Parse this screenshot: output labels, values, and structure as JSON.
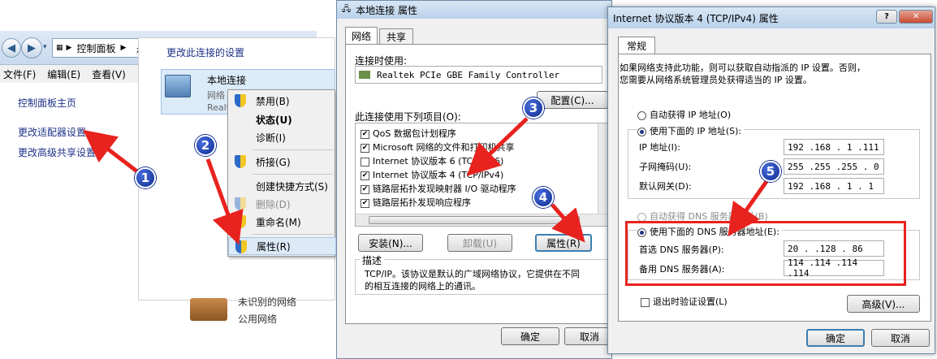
{
  "explorer": {
    "address": "控制面板",
    "address_tail": "核",
    "menu": [
      "文件(F)",
      "编辑(E)",
      "查看(V)"
    ],
    "links": [
      "控制面板主页",
      "更改适配器设置",
      "更改高级共享设置"
    ]
  },
  "adapters": {
    "header": "更改此连接的设置",
    "connection_name": "本地连接",
    "connection_sub1": "网络",
    "connection_sub2": "Realt",
    "unidentified": "未识别的网络",
    "public": "公用网络"
  },
  "context_menu": {
    "items": [
      {
        "label": "禁用(B)"
      },
      {
        "label": "状态(U)"
      },
      {
        "label": "诊断(I)"
      },
      {
        "label": "桥接(G)"
      },
      {
        "label": "创建快捷方式(S)"
      },
      {
        "label": "删除(D)"
      },
      {
        "label": "重命名(M)"
      },
      {
        "label": "属性(R)"
      }
    ]
  },
  "props": {
    "title": "本地连接 属性",
    "tabs": [
      "网络",
      "共享"
    ],
    "connect_using": "连接时使用:",
    "adapter": "Realtek PCIe GBE Family Controller",
    "configure": "配置(C)...",
    "items_label": "此连接使用下列项目(O):",
    "items": [
      {
        "label": "QoS 数据包计划程序",
        "checked": "✔"
      },
      {
        "label": "Microsoft 网络的文件和打印机共享",
        "checked": "✔"
      },
      {
        "label": "Internet 协议版本 6 (TCP/IPv6)",
        "checked": ""
      },
      {
        "label": "Internet 协议版本 4 (TCP/IPv4)",
        "checked": "✔"
      },
      {
        "label": "链路层拓扑发现映射器 I/O 驱动程序",
        "checked": "✔"
      },
      {
        "label": "链路层拓扑发现响应程序",
        "checked": "✔"
      }
    ],
    "install": "安装(N)...",
    "uninstall": "卸载(U)",
    "properties": "属性(R)",
    "desc_title": "描述",
    "desc_line1": "TCP/IP。该协议是默认的广域网络协议，它提供在不同",
    "desc_line2": "的相互连接的网络上的通讯。",
    "ok": "确定",
    "cancel": "取消"
  },
  "ipv4": {
    "title": "Internet 协议版本 4 (TCP/IPv4) 属性",
    "help_btn": "?",
    "close_btn": "✕",
    "tab": "常规",
    "intro1": "如果网络支持此功能，则可以获取自动指派的 IP 设置。否则，",
    "intro2": "您需要从网络系统管理员处获得适当的 IP 设置。",
    "auto_ip": "自动获得 IP 地址(O)",
    "manual_ip": "使用下面的 IP 地址(S):",
    "ip_label": "IP 地址(I):",
    "ip_value": "192 .168 . 1 .111",
    "mask_label": "子网掩码(U):",
    "mask_value": "255 .255 .255 . 0",
    "gateway_label": "默认网关(D):",
    "gateway_value": "192 .168 . 1 . 1",
    "auto_dns": "自动获得 DNS 服务器地址(B)",
    "manual_dns": "使用下面的 DNS 服务器地址(E):",
    "dns1_label": "首选 DNS 服务器(P):",
    "dns1_value": "20    .    .128 . 86",
    "dns2_label": "备用 DNS 服务器(A):",
    "dns2_value": "114 .114 .114 .114",
    "validate": "退出时验证设置(L)",
    "advanced": "高级(V)...",
    "ok": "确定",
    "cancel": "取消"
  },
  "callouts": [
    "1",
    "2",
    "3",
    "4",
    "5"
  ],
  "colors": {
    "arrow": "#e8231f",
    "highlight": "#e8231f",
    "callout": "#1a3aa8"
  }
}
